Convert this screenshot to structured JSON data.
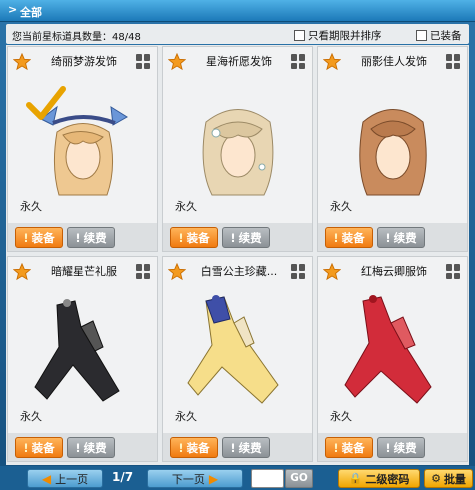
{
  "header": {
    "arrow_icon": "chevron-right-icon",
    "title": "全部"
  },
  "info": {
    "count_text": "您当前星标道具数量：48/48",
    "filter_expiring_label": "只看期限并排序",
    "filter_equipped_label": "已装备"
  },
  "items": [
    {
      "name": "绮丽梦游发饰",
      "duration": "永久",
      "equip_label": "装备",
      "renew_label": "续费",
      "equipped": true
    },
    {
      "name": "星海祈愿发饰",
      "duration": "永久",
      "equip_label": "装备",
      "renew_label": "续费",
      "equipped": false
    },
    {
      "name": "丽影佳人发饰",
      "duration": "永久",
      "equip_label": "装备",
      "renew_label": "续费",
      "equipped": false
    },
    {
      "name": "暗耀星芒礼服",
      "duration": "永久",
      "equip_label": "装备",
      "renew_label": "续费",
      "equipped": false
    },
    {
      "name": "白雪公主珍藏...",
      "duration": "永久",
      "equip_label": "装备",
      "renew_label": "续费",
      "equipped": false
    },
    {
      "name": "红梅云卿服饰",
      "duration": "永久",
      "equip_label": "装备",
      "renew_label": "续费",
      "equipped": false
    }
  ],
  "pager": {
    "prev_label": "上一页",
    "page_text": "1/7",
    "next_label": "下一页",
    "go_label": "GO",
    "password_label": "二级密码",
    "batch_label": "批量"
  },
  "colors": {
    "accent_orange": "#f07a10",
    "header_blue": "#1c79b8",
    "star_orange": "#f39a1e"
  }
}
